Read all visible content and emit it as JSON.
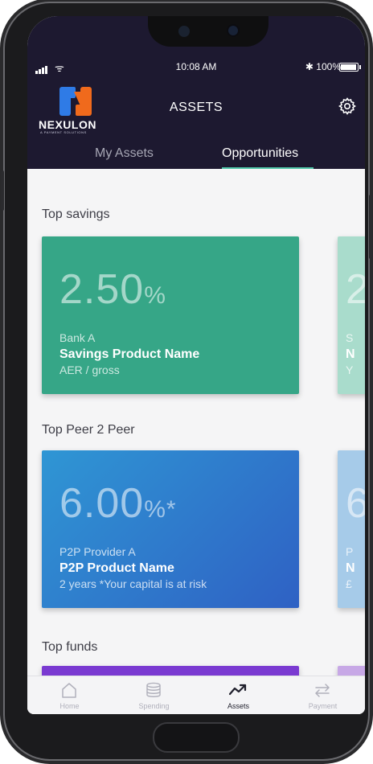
{
  "status_bar": {
    "time": "10:08 AM",
    "battery": "100%",
    "bluetooth_glyph": "✱",
    "wifi_glyph": "ᯤ"
  },
  "header": {
    "logo_name": "NEXULON",
    "logo_tagline": "A PAYMENT SOLUTIONS",
    "title": "ASSETS",
    "settings_icon": "gear-icon"
  },
  "tabs": [
    {
      "label": "My Assets",
      "active": false
    },
    {
      "label": "Opportunities",
      "active": true
    }
  ],
  "sections": [
    {
      "title": "Top savings",
      "cards": [
        {
          "rate": "2.50",
          "suffix": "%",
          "provider": "Bank A",
          "product": "Savings Product Name",
          "note": "AER / gross"
        },
        {
          "rate": "2",
          "suffix": "",
          "provider": "S",
          "product": "N",
          "note": "Y"
        }
      ]
    },
    {
      "title": "Top Peer 2 Peer",
      "cards": [
        {
          "rate": "6.00",
          "suffix": "%*",
          "provider": "P2P Provider A",
          "product": "P2P Product Name",
          "note": "2 years *Your capital is at risk"
        },
        {
          "rate": "6",
          "suffix": "",
          "provider": "P",
          "product": "N",
          "note": "£"
        }
      ]
    },
    {
      "title": "Top funds",
      "cards": []
    }
  ],
  "bottom_nav": [
    {
      "label": "Home",
      "icon": "home-icon",
      "active": false
    },
    {
      "label": "Spending",
      "icon": "coins-icon",
      "active": false
    },
    {
      "label": "Assets",
      "icon": "trend-up-icon",
      "active": true
    },
    {
      "label": "Payment",
      "icon": "transfer-icon",
      "active": false
    }
  ],
  "colors": {
    "header_bg": "#1d1930",
    "savings_card": "#36a687",
    "p2p_card_start": "#2f96d4",
    "p2p_card_end": "#2f61c4",
    "funds_card": "#7a3ad1",
    "tab_accent": "#4fc7a9"
  }
}
